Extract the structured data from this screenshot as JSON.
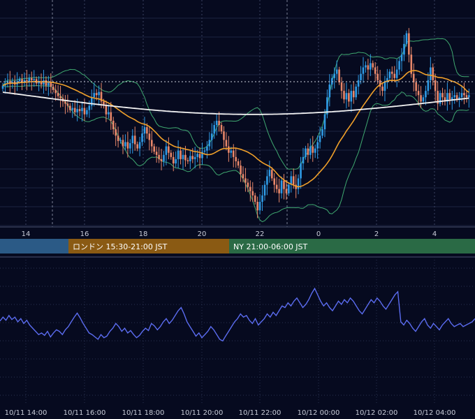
{
  "chart_data": {
    "type": "candlestick",
    "colors": {
      "background": "#060a1f",
      "up": "#2f9be6",
      "down": "#e8876a",
      "ma_short": "#f0a02a",
      "ma_long": "#f2f2f2",
      "bollinger": "#3fa870",
      "oscillator": "#5b6cf0",
      "grid": "#1c2440"
    },
    "price_axis": {
      "x_ticks": [
        "14",
        "16",
        "18",
        "20",
        "22",
        "0",
        "2",
        "4"
      ]
    },
    "sessions": [
      {
        "label": "",
        "color": "#2b5a86"
      },
      {
        "label": "ロンドン 15:30-21:00 JST",
        "color": "#8a5a13"
      },
      {
        "label": "NY 21:00-06:00 JST",
        "color": "#2a6a45"
      }
    ],
    "oscillator_axis": {
      "x_ticks": [
        "10/11 14:00",
        "10/11 16:00",
        "10/11 18:00",
        "10/11 20:00",
        "10/11 22:00",
        "10/12 00:00",
        "10/12 02:00",
        "10/12 04:00"
      ]
    },
    "close_series": [
      0.1,
      0.3,
      0.5,
      0.3,
      0.45,
      0.2,
      0.5,
      0.7,
      0.4,
      0.6,
      0.5,
      0.8,
      0.6,
      0.7,
      0.3,
      0.5,
      0.2,
      0.6,
      0.1,
      0.4,
      0.0,
      -0.3,
      -0.6,
      -0.9,
      -1.1,
      -1.4,
      -1.6,
      -1.8,
      -2.2,
      -2.0,
      -2.4,
      -2.1,
      -2.3,
      -2.0,
      -2.6,
      -2.2,
      -1.8,
      -1.0,
      -0.6,
      -0.8,
      -0.5,
      -1.4,
      -1.8,
      -2.6,
      -2.4,
      -3.2,
      -4.0,
      -4.6,
      -5.1,
      -5.0,
      -5.6,
      -5.2,
      -5.8,
      -5.3,
      -4.6,
      -5.4,
      -5.8,
      -5.2,
      -4.4,
      -3.8,
      -4.4,
      -5.0,
      -5.6,
      -6.1,
      -6.4,
      -6.8,
      -7.0,
      -6.4,
      -5.6,
      -6.2,
      -6.6,
      -7.2,
      -6.8,
      -6.0,
      -6.8,
      -6.4,
      -6.9,
      -7.0,
      -6.5,
      -6.8,
      -6.6,
      -6.3,
      -6.7,
      -6.1,
      -6.0,
      -5.6,
      -5.0,
      -4.4,
      -3.6,
      -3.2,
      -3.6,
      -4.2,
      -5.0,
      -5.6,
      -6.2,
      -6.0,
      -6.6,
      -7.0,
      -7.4,
      -8.2,
      -8.6,
      -9.0,
      -9.4,
      -9.8,
      -10.2,
      -10.8,
      -11.6,
      -10.8,
      -10.2,
      -9.2,
      -8.4,
      -7.8,
      -8.6,
      -9.2,
      -9.6,
      -10.0,
      -8.8,
      -9.6,
      -10.0,
      -9.2,
      -8.4,
      -9.2,
      -9.6,
      -8.6,
      -7.2,
      -6.6,
      -5.8,
      -6.4,
      -5.6,
      -6.2,
      -5.8,
      -5.2,
      -4.6,
      -4.0,
      -2.6,
      -1.0,
      0.2,
      0.8,
      1.2,
      1.6,
      0.4,
      -0.4,
      -1.2,
      -0.6,
      -1.4,
      -0.4,
      -1.0,
      0.0,
      0.6,
      1.2,
      1.8,
      2.0,
      1.6,
      2.2,
      1.8,
      1.2,
      0.6,
      0.0,
      -0.4,
      0.4,
      0.8,
      1.4,
      1.2,
      0.8,
      1.6,
      2.4,
      3.0,
      4.0,
      5.0,
      3.0,
      1.2,
      0.4,
      -0.4,
      -0.8,
      -1.4,
      -1.0,
      -0.4,
      0.6,
      1.8,
      0.6,
      -0.4,
      -1.6,
      -0.6,
      -1.0,
      -1.4,
      -0.6,
      -1.2,
      -1.0,
      -0.8,
      -1.2,
      -1.0,
      -0.6,
      -0.8,
      -1.0,
      -0.8
    ],
    "oscillator_values": [
      0.53,
      0.58,
      0.54,
      0.6,
      0.55,
      0.58,
      0.52,
      0.56,
      0.5,
      0.54,
      0.48,
      0.44,
      0.4,
      0.36,
      0.38,
      0.35,
      0.4,
      0.33,
      0.38,
      0.42,
      0.4,
      0.36,
      0.42,
      0.46,
      0.52,
      0.58,
      0.63,
      0.57,
      0.5,
      0.44,
      0.38,
      0.36,
      0.33,
      0.3,
      0.36,
      0.32,
      0.34,
      0.4,
      0.44,
      0.5,
      0.46,
      0.4,
      0.44,
      0.38,
      0.41,
      0.36,
      0.32,
      0.35,
      0.4,
      0.44,
      0.41,
      0.5,
      0.47,
      0.42,
      0.46,
      0.52,
      0.56,
      0.5,
      0.54,
      0.6,
      0.66,
      0.7,
      0.62,
      0.52,
      0.46,
      0.4,
      0.34,
      0.38,
      0.32,
      0.36,
      0.4,
      0.46,
      0.42,
      0.36,
      0.3,
      0.28,
      0.34,
      0.4,
      0.46,
      0.52,
      0.56,
      0.62,
      0.58,
      0.6,
      0.54,
      0.5,
      0.56,
      0.48,
      0.52,
      0.56,
      0.62,
      0.58,
      0.64,
      0.6,
      0.66,
      0.72,
      0.7,
      0.76,
      0.72,
      0.78,
      0.82,
      0.76,
      0.7,
      0.74,
      0.8,
      0.88,
      0.94,
      0.86,
      0.78,
      0.72,
      0.76,
      0.7,
      0.66,
      0.72,
      0.78,
      0.74,
      0.8,
      0.76,
      0.82,
      0.78,
      0.72,
      0.66,
      0.62,
      0.68,
      0.74,
      0.8,
      0.76,
      0.82,
      0.78,
      0.72,
      0.68,
      0.74,
      0.8,
      0.86,
      0.9,
      0.52,
      0.48,
      0.54,
      0.5,
      0.44,
      0.4,
      0.46,
      0.52,
      0.56,
      0.48,
      0.44,
      0.5,
      0.46,
      0.42,
      0.48,
      0.52,
      0.56,
      0.5,
      0.46,
      0.48,
      0.5,
      0.46,
      0.48,
      0.5,
      0.52,
      0.56
    ]
  }
}
